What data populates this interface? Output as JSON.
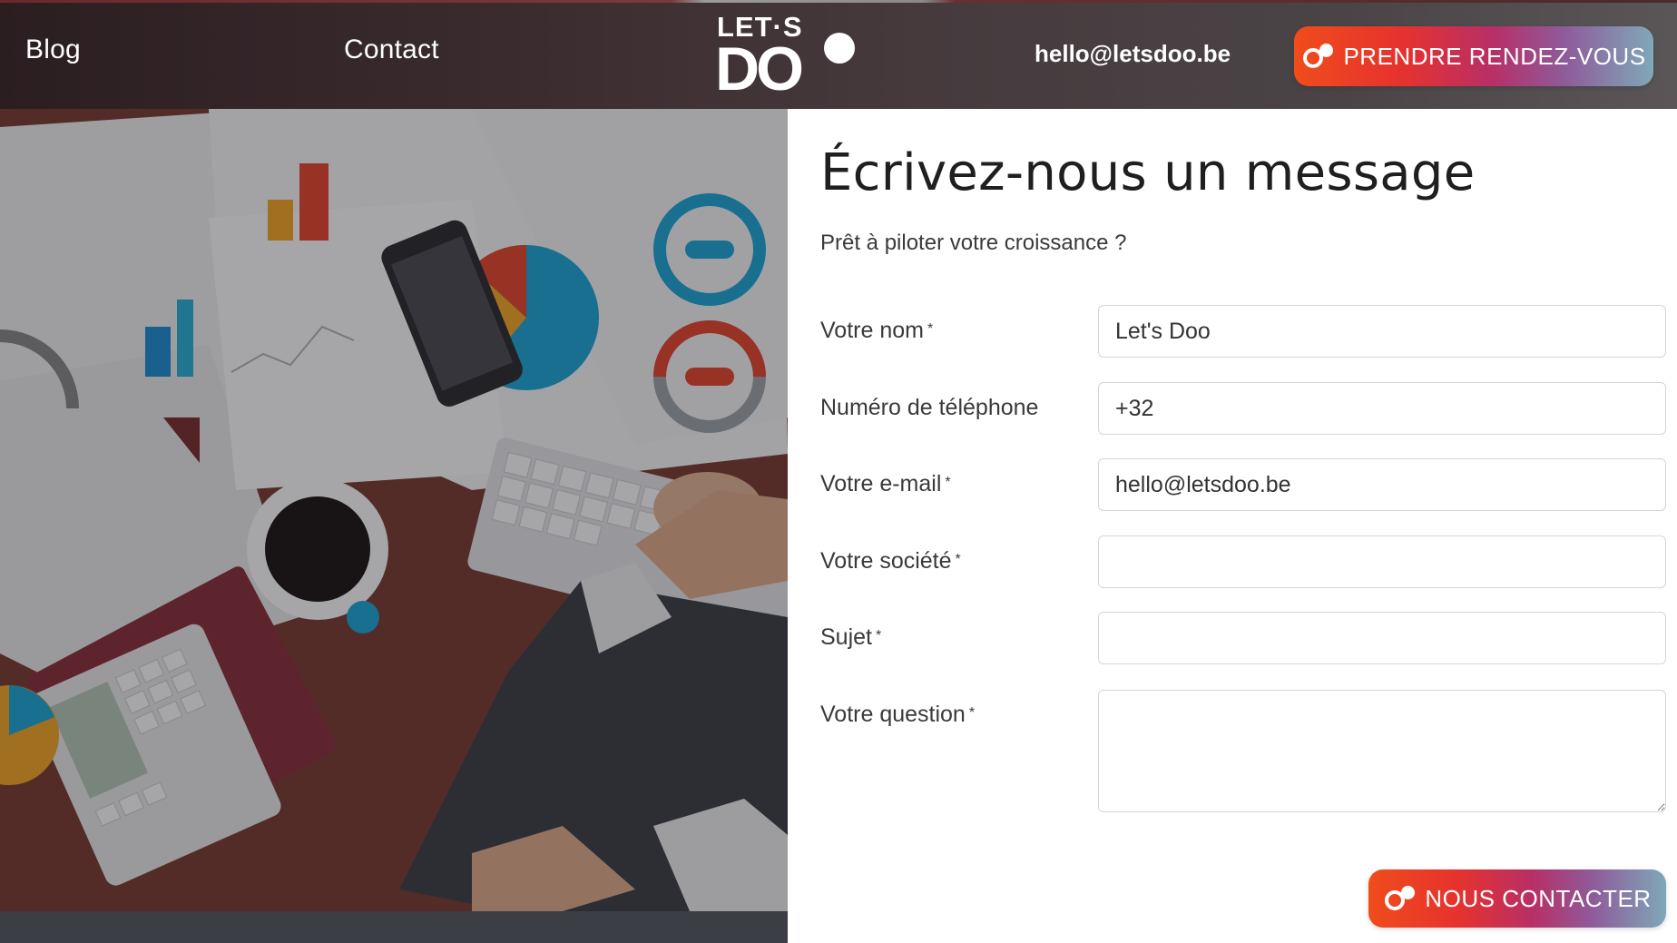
{
  "header": {
    "nav": [
      {
        "label": "Blog"
      },
      {
        "label": "Contact"
      }
    ],
    "logo": {
      "top": "LET·S",
      "bottom": "DO"
    },
    "email": "hello@letsdoo.be",
    "cta_label": "PRENDRE RENDEZ-VOUS",
    "cta_icon": "logo-dot-icon"
  },
  "hero_image": {
    "subject": "office desk with charts, phone, coffee, calculator, keyboard"
  },
  "form": {
    "title": "Écrivez-nous un message",
    "subtitle": "Prêt à piloter votre croissance ?",
    "required_marker": "*",
    "fields": [
      {
        "label": "Votre nom",
        "required": true,
        "value": "Let's Doo"
      },
      {
        "label": "Numéro de téléphone",
        "required": false,
        "value": "+32"
      },
      {
        "label": "Votre e-mail",
        "required": true,
        "value": "hello@letsdoo.be"
      },
      {
        "label": "Votre société",
        "required": true,
        "value": ""
      },
      {
        "label": "Sujet",
        "required": true,
        "value": ""
      },
      {
        "label": "Votre question",
        "required": true,
        "value": ""
      }
    ],
    "submit_label": "NOUS CONTACTER"
  },
  "colors": {
    "cta_gradient_start": "#f04c1c",
    "cta_gradient_mid": "#b82f66",
    "cta_gradient_end": "#7fa8b8",
    "header_bg": "#3a2b2e",
    "title_text": "#1f1f1f"
  }
}
